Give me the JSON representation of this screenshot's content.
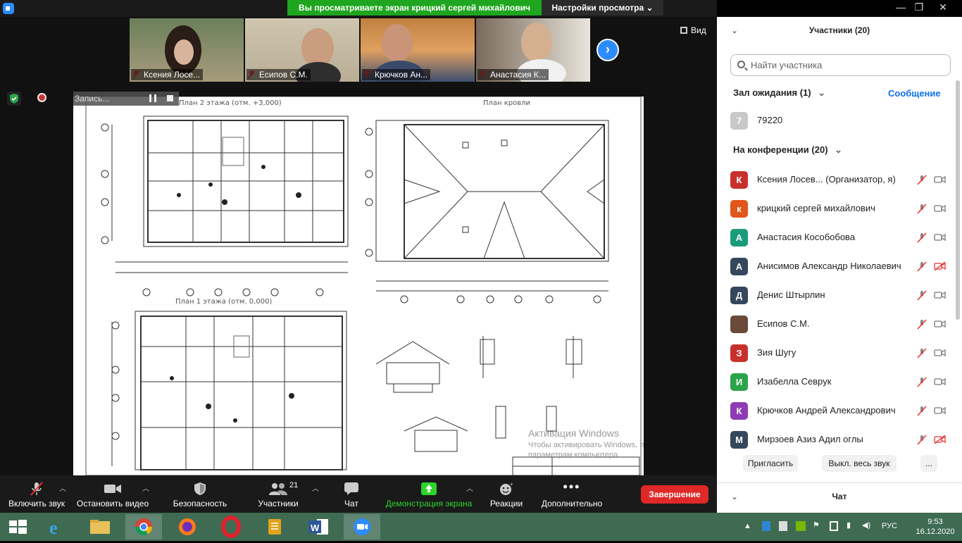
{
  "window": {
    "banner": "Вы просматриваете экран крицкий сергей михайлович",
    "view_settings": "Настройки просмотра",
    "view_button": "Вид"
  },
  "thumbnails": [
    {
      "name": "Ксения Лосе..."
    },
    {
      "name": "Есипов С.М."
    },
    {
      "name": "Крючков Ан..."
    },
    {
      "name": "Анастасия К..."
    }
  ],
  "recording": {
    "label": "Запись..."
  },
  "shared_screen": {
    "plan_floor2": "План 2 этажа (отм. +3,000)",
    "plan_roof": "План кровли",
    "plan_floor1": "План 1 этажа (отм. 0,000)",
    "watermark_title": "Активация Windows",
    "watermark_line1": "Чтобы активировать Windows, перейдите к",
    "watermark_line2": "параметрам компьютера."
  },
  "toolbar": {
    "mute": "Включить звук",
    "video": "Остановить видео",
    "security": "Безопасность",
    "participants": "Участники",
    "participants_count": "21",
    "chat": "Чат",
    "share": "Демонстрация экрана",
    "reactions": "Реакции",
    "more": "Дополнительно",
    "end": "Завершение"
  },
  "panel": {
    "title": "Участники (20)",
    "search_placeholder": "Найти участника",
    "waiting_room": "Зал ожидания (1)",
    "message": "Сообщение",
    "waiting": [
      {
        "initial": "7",
        "name": "79220",
        "color": "#c8c8c8"
      }
    ],
    "in_meeting": "На конференции (20)",
    "participants": [
      {
        "initial": "К",
        "name": "Ксения Лосев...  (Организатор, я)",
        "color": "#c8302c",
        "cam_off": false
      },
      {
        "initial": "к",
        "name": "крицкий сергей михайлович",
        "color": "#e0561b",
        "cam_off": false
      },
      {
        "initial": "А",
        "name": "Анастасия Кособобова",
        "color": "#1a9c7a",
        "cam_off": false
      },
      {
        "initial": "А",
        "name": "Анисимов Александр Николаевич",
        "color": "#35475c",
        "cam_off": true
      },
      {
        "initial": "Д",
        "name": "Денис Штырлин",
        "color": "#35475c",
        "cam_off": false
      },
      {
        "initial": "",
        "name": "Есипов С.М.",
        "color": "#6b4a3a",
        "cam_off": false
      },
      {
        "initial": "З",
        "name": "Зия Шугу",
        "color": "#c8302c",
        "cam_off": false
      },
      {
        "initial": "И",
        "name": "Изабелла Севрук",
        "color": "#2ba34a",
        "cam_off": false
      },
      {
        "initial": "К",
        "name": "Крючков Андрей Александрович",
        "color": "#8e3bb5",
        "cam_off": false
      },
      {
        "initial": "М",
        "name": "Мирзоев Азиз Адил оглы",
        "color": "#35475c",
        "cam_off": true
      }
    ],
    "invite": "Пригласить",
    "mute_all": "Выкл. весь звук",
    "more": "...",
    "chat": "Чат"
  },
  "taskbar": {
    "lang": "РУС",
    "time": "9:53",
    "date": "16.12.2020"
  }
}
